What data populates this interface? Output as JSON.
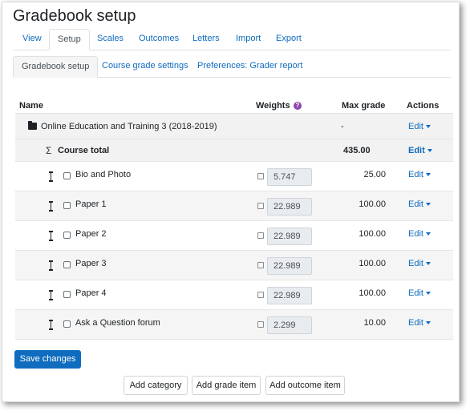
{
  "page": {
    "title": "Gradebook setup"
  },
  "nav_tabs": [
    "View",
    "Setup",
    "Scales",
    "Outcomes",
    "Letters",
    "Import",
    "Export"
  ],
  "sub_tabs": [
    "Gradebook setup",
    "Course grade settings",
    "Preferences: Grader report"
  ],
  "table": {
    "headers": {
      "name": "Name",
      "weights": "Weights",
      "max_grade": "Max grade",
      "actions": "Actions"
    },
    "category": {
      "name": "Online Education and Training 3 (2018-2019)",
      "max_grade": "-",
      "action": "Edit"
    },
    "total": {
      "symbol": "Σ",
      "name": "Course total",
      "max_grade": "435.00",
      "action": "Edit"
    },
    "items": [
      {
        "name": "Bio and Photo",
        "weight": "5.747",
        "max_grade": "25.00",
        "action": "Edit"
      },
      {
        "name": "Paper 1",
        "weight": "22.989",
        "max_grade": "100.00",
        "action": "Edit"
      },
      {
        "name": "Paper 2",
        "weight": "22.989",
        "max_grade": "100.00",
        "action": "Edit"
      },
      {
        "name": "Paper 3",
        "weight": "22.989",
        "max_grade": "100.00",
        "action": "Edit"
      },
      {
        "name": "Paper 4",
        "weight": "22.989",
        "max_grade": "100.00",
        "action": "Edit"
      },
      {
        "name": "Ask a Question forum",
        "weight": "2.299",
        "max_grade": "10.00",
        "action": "Edit"
      }
    ]
  },
  "buttons": {
    "save": "Save changes",
    "add_category": "Add category",
    "add_grade_item": "Add grade item",
    "add_outcome_item": "Add outcome item"
  },
  "colors": {
    "primary": "#0f6cbf",
    "help_icon": "#8e44ad"
  }
}
